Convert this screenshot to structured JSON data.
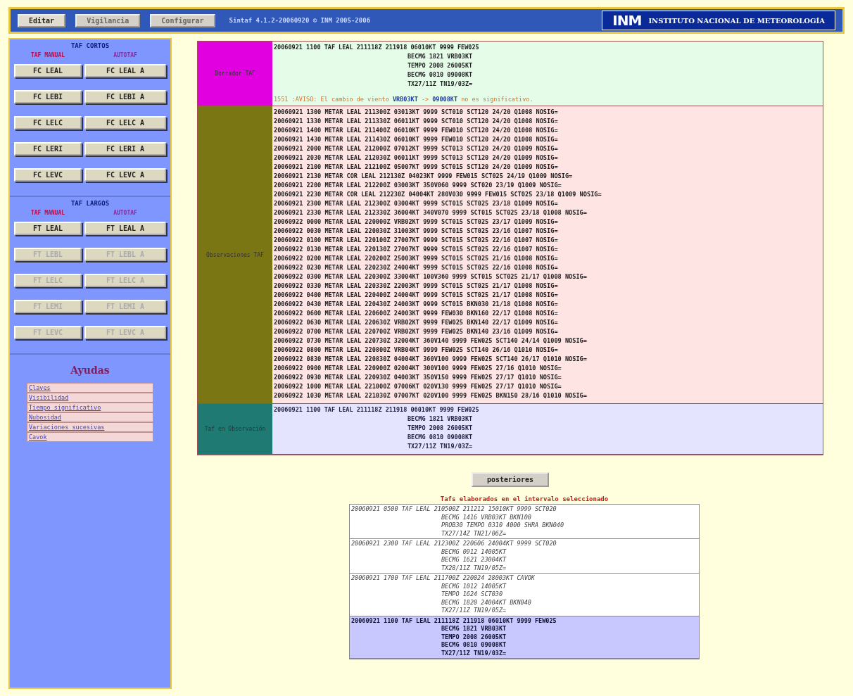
{
  "menu": [
    {
      "label": "Editar",
      "selected": true
    },
    {
      "label": "Vigilancia",
      "selected": false
    },
    {
      "label": "Configurar",
      "selected": false
    }
  ],
  "version": "Sintaf 4.1.2-20060920 © INM 2005-2006",
  "logo": {
    "mark": "INM",
    "name": "INSTITUTO NACIONAL DE METEOROLOGÍA"
  },
  "sidebar": {
    "groups": [
      {
        "title": "TAF CORTOS",
        "col_manual": "TAF MANUAL",
        "col_auto": "AUTOTAF",
        "buttons": [
          {
            "manual": "FC LEAL",
            "auto": "FC LEAL A",
            "disabled": false
          },
          {
            "manual": "FC LEBI",
            "auto": "FC LEBI A",
            "disabled": false
          },
          {
            "manual": "FC LELC",
            "auto": "FC LELC A",
            "disabled": false
          },
          {
            "manual": "FC LERI",
            "auto": "FC LERI A",
            "disabled": false
          },
          {
            "manual": "FC LEVC",
            "auto": "FC LEVC A",
            "disabled": false
          }
        ]
      },
      {
        "title": "TAF LARGOS",
        "col_manual": "TAF MANUAL",
        "col_auto": "AUTOTAF",
        "buttons": [
          {
            "manual": "FT LEAL",
            "auto": "FT LEAL A",
            "disabled": false
          },
          {
            "manual": "FT LEBL",
            "auto": "FT LEBL A",
            "disabled": true
          },
          {
            "manual": "FT LELC",
            "auto": "FT LELC A",
            "disabled": true
          },
          {
            "manual": "FT LEMI",
            "auto": "FT LEMI A",
            "disabled": true
          },
          {
            "manual": "FT LEVC",
            "auto": "FT LEVC A",
            "disabled": true
          }
        ]
      }
    ],
    "help_title": "Ayudas",
    "help_links": [
      "Claves",
      "Visibilidad",
      "Tiempo significativo",
      "Nubosidad",
      "Variaciones sucesivas",
      "Cavok"
    ]
  },
  "panels": [
    {
      "kind": "draft",
      "label": "Borrador TAF",
      "lines": [
        "20060921 1100 TAF LEAL 211118Z 211918 06010KT 9999 FEW025",
        "BECMG 1821 VRB03KT",
        "TEMPO 2008 26005KT",
        "BECMG 0810 09008KT",
        "TX27/11Z TN19/03Z="
      ],
      "warning": {
        "time": "1551",
        "label": ":AVISO:",
        "text": "El cambio de viento",
        "from": "VRB03KT",
        "arrow": "->",
        "to": "09008KT",
        "tail": "no es significativo."
      }
    },
    {
      "kind": "obs",
      "label": "Observaciones TAF",
      "lines": [
        "20060921 1300 METAR LEAL 211300Z 03013KT 9999 SCT010 SCT120 24/20 Q1008 NOSIG=",
        "20060921 1330 METAR LEAL 211330Z 06011KT 9999 SCT010 SCT120 24/20 Q1008 NOSIG=",
        "20060921 1400 METAR LEAL 211400Z 06010KT 9999 FEW010 SCT120 24/20 Q1008 NOSIG=",
        "20060921 1430 METAR LEAL 211430Z 06010KT 9999 FEW010 SCT120 24/20 Q1008 NOSIG=",
        "20060921 2000 METAR LEAL 212000Z 07012KT 9999 SCT013 SCT120 24/20 Q1009 NOSIG=",
        "20060921 2030 METAR LEAL 212030Z 06011KT 9999 SCT013 SCT120 24/20 Q1009 NOSIG=",
        "20060921 2100 METAR LEAL 212100Z 05007KT 9999 SCT015 SCT120 24/20 Q1009 NOSIG=",
        "20060921 2130 METAR COR LEAL 212130Z 04023KT 9999 FEW015 SCT025 24/19 Q1009 NOSIG=",
        "20060921 2200 METAR LEAL 212200Z 03003KT 350V060 9999 SCT020 23/19 Q1009 NOSIG=",
        "20060921 2230 METAR COR LEAL 212230Z 04004KT 280V030 9999 FEW015 SCT025 23/18 Q1009 NOSIG=",
        "20060921 2300 METAR LEAL 212300Z 03004KT 9999 SCT015 SCT025 23/18 Q1009 NOSIG=",
        "20060921 2330 METAR LEAL 212330Z 36004KT 340V070 9999 SCT015 SCT025 23/18 Q1008 NOSIG=",
        "20060922 0000 METAR LEAL 220000Z VRB02KT 9999 SCT015 SCT025 23/17 Q1009 NOSIG=",
        "20060922 0030 METAR LEAL 220030Z 31003KT 9999 SCT015 SCT025 23/16 Q1007 NOSIG=",
        "20060922 0100 METAR LEAL 220100Z 27007KT 9999 SCT015 SCT025 22/16 Q1007 NOSIG=",
        "20060922 0130 METAR LEAL 220130Z 27007KT 9999 SCT015 SCT025 22/16 Q1007 NOSIG=",
        "20060922 0200 METAR LEAL 220200Z 25003KT 9999 SCT015 SCT025 21/16 Q1008 NOSIG=",
        "20060922 0230 METAR LEAL 220230Z 24004KT 9999 SCT015 SCT025 22/16 Q1008 NOSIG=",
        "20060922 0300 METAR LEAL 220300Z 33004KT 100V360 9999 SCT015 SCT025 21/17 Q1008 NOSIG=",
        "20060922 0330 METAR LEAL 220330Z 22003KT 9999 SCT015 SCT025 21/17 Q1008 NOSIG=",
        "20060922 0400 METAR LEAL 220400Z 24004KT 9999 SCT015 SCT025 21/17 Q1008 NOSIG=",
        "20060922 0430 METAR LEAL 220430Z 24003KT 9999 SCT015 BKN030 21/18 Q1008 NOSIG=",
        "20060922 0600 METAR LEAL 220600Z 24003KT 9999 FEW030 BKN160 22/17 Q1008 NOSIG=",
        "20060922 0630 METAR LEAL 220630Z VRB02KT 9999 FEW025 BKN140 22/17 Q1009 NOSIG=",
        "20060922 0700 METAR LEAL 220700Z VRB02KT 9999 FEW025 BKN140 23/16 Q1009 NOSIG=",
        "20060922 0730 METAR LEAL 220730Z 32004KT 360V140 9999 FEW025 SCT140 24/14 Q1009 NOSIG=",
        "20060922 0800 METAR LEAL 220800Z VRB04KT 9999 FEW025 SCT140 26/16 Q1010 NOSIG=",
        "20060922 0830 METAR LEAL 220830Z 04004KT 360V100 9999 FEW025 SCT140 26/17 Q1010 NOSIG=",
        "20060922 0900 METAR LEAL 220900Z 02004KT 300V100 9999 FEW025 27/16 Q1010 NOSIG=",
        "20060922 0930 METAR LEAL 220930Z 04003KT 350V150 9999 FEW025 27/17 Q1010 NOSIG=",
        "20060922 1000 METAR LEAL 221000Z 07006KT 020V130 9999 FEW025 27/17 Q1010 NOSIG=",
        "20060922 1030 METAR LEAL 221030Z 07007KT 020V100 9999 FEW025 BKN150 28/16 Q1010 NOSIG="
      ]
    },
    {
      "kind": "watch",
      "label": "Taf en Observación",
      "lines": [
        "20060921 1100 TAF LEAL 211118Z 211918 06010KT 9999 FEW025",
        "BECMG 1821 VRB03KT",
        "TEMPO 2008 26005KT",
        "BECMG 0810 09008KT",
        "TX27/11Z TN19/03Z="
      ]
    }
  ],
  "nav_button": "posteriores",
  "history_title": "Tafs elaborados en el intervalo seleccionado",
  "history": [
    {
      "selected": false,
      "lines": [
        "20060921 0500 TAF LEAL 210500Z 211212 15010KT 9999 SCT020",
        "BECMG 1416 VRB03KT BKN100",
        "PROB30 TEMPO 0310 4000 SHRA BKN040",
        "TX27/14Z TN21/06Z="
      ]
    },
    {
      "selected": false,
      "lines": [
        "20060921 2300 TAF LEAL 212300Z 220606 24004KT 9999 SCT020",
        "BECMG 0912 14005KT",
        "BECMG 1621 23004KT",
        "TX28/11Z TN19/05Z="
      ]
    },
    {
      "selected": false,
      "lines": [
        "20060921 1700 TAF LEAL 211700Z 220024 28003KT CAVOK",
        "BECMG 1012 14005KT",
        "TEMPO 1624 SCT030",
        "BECMG 1820 24004KT BKN040",
        "TX27/11Z TN19/05Z="
      ]
    },
    {
      "selected": true,
      "lines": [
        "20060921 1100 TAF LEAL 211118Z 211918 06010KT 9999 FEW025",
        "BECMG 1821 VRB03KT",
        "TEMPO 2008 26005KT",
        "BECMG 0810 09008KT",
        "TX27/11Z TN19/03Z="
      ]
    }
  ]
}
